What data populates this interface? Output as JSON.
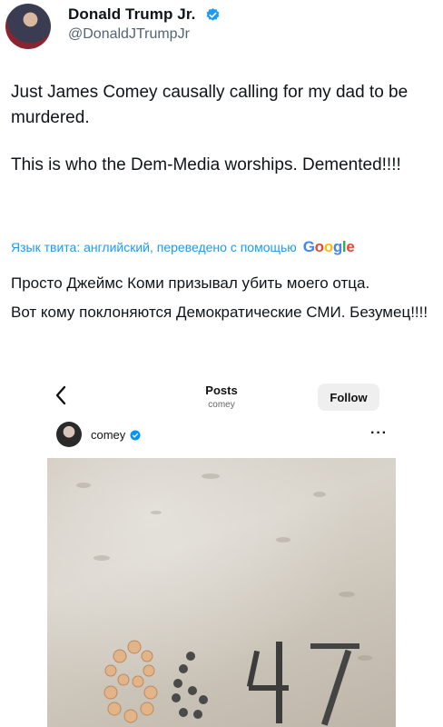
{
  "author": {
    "name": "Donald Trump Jr.",
    "handle": "@DonaldJTrumpJr",
    "verified_color": "#1d9bf0"
  },
  "tweet": {
    "paragraphs": [
      "Just James Comey causally calling for my dad to be murdered.",
      "This is who the Dem-Media worships. Demented!!!!"
    ]
  },
  "translation": {
    "credit": "Язык твита: английский, переведено с помощью",
    "google_letters": [
      "G",
      "o",
      "o",
      "g",
      "l",
      "e"
    ],
    "paragraphs": [
      "Просто Джеймс Коми призывал убить моего отца.",
      "Вот кому поклоняются Демократические СМИ. Безумец!!!!"
    ]
  },
  "embed": {
    "title": "Posts",
    "subtitle": "comey",
    "follow_label": "Follow",
    "post_username": "comey",
    "more_label": "···",
    "back_label": "‹"
  },
  "photo": {
    "description_icons": [
      "shell-number-icon"
    ]
  }
}
